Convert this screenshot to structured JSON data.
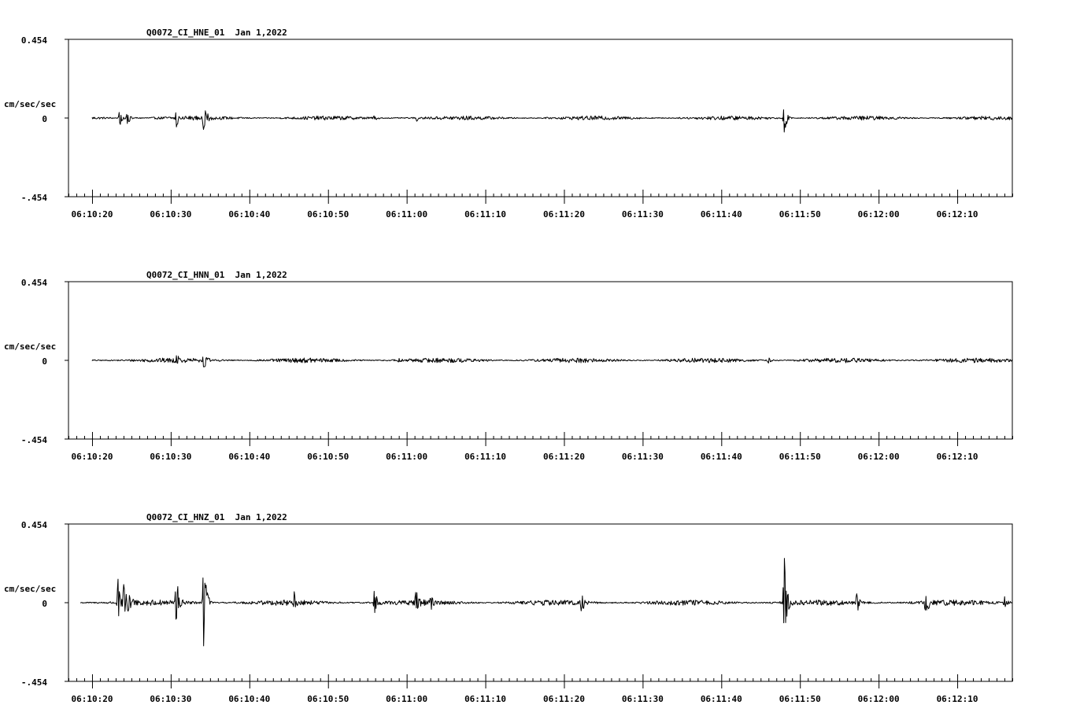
{
  "chart_data": [
    {
      "type": "line",
      "title": "Q0072_CI_HNE_01  Jan 1,2022",
      "ylabel": "cm/sec/sec",
      "ylim": [
        -0.454,
        0.454
      ],
      "y_tick_labels": [
        "0.454",
        "0",
        "-.454"
      ],
      "xlim_seconds_of_day": [
        22217.0,
        22337.0
      ],
      "x_tick_labels": [
        "06:10:20",
        "06:10:30",
        "06:10:40",
        "06:10:50",
        "06:11:00",
        "06:11:10",
        "06:11:20",
        "06:11:30",
        "06:11:40",
        "06:11:50",
        "06:12:00",
        "06:12:10"
      ],
      "grid": false,
      "series": [
        {
          "start_time": "06:10:20",
          "noise_amplitude": 0.012,
          "events": [
            {
              "time": "06:10:23.5",
              "amplitude": 0.05
            },
            {
              "time": "06:10:24.5",
              "amplitude": 0.05
            },
            {
              "time": "06:10:30.7",
              "amplitude": 0.06
            },
            {
              "time": "06:10:34.2",
              "amplitude": 0.11
            },
            {
              "time": "06:10:55.9",
              "amplitude": 0.02
            },
            {
              "time": "06:11:01.2",
              "amplitude": 0.02
            },
            {
              "time": "06:11:48.0",
              "amplitude": 0.1
            }
          ]
        }
      ]
    },
    {
      "type": "line",
      "title": "Q0072_CI_HNN_01  Jan 1,2022",
      "ylabel": "cm/sec/sec",
      "ylim": [
        -0.454,
        0.454
      ],
      "y_tick_labels": [
        "0.454",
        "0",
        "-.454"
      ],
      "xlim_seconds_of_day": [
        22217.0,
        22337.0
      ],
      "x_tick_labels": [
        "06:10:20",
        "06:10:30",
        "06:10:40",
        "06:10:50",
        "06:11:00",
        "06:11:10",
        "06:11:20",
        "06:11:30",
        "06:11:40",
        "06:11:50",
        "06:12:00",
        "06:12:10"
      ],
      "grid": false,
      "series": [
        {
          "start_time": "06:10:20",
          "noise_amplitude": 0.014,
          "events": [
            {
              "time": "06:10:30.7",
              "amplitude": 0.03
            },
            {
              "time": "06:10:34.2",
              "amplitude": 0.06
            },
            {
              "time": "06:10:59.0",
              "amplitude": 0.02
            },
            {
              "time": "06:11:46.0",
              "amplitude": 0.02
            }
          ]
        }
      ]
    },
    {
      "type": "line",
      "title": "Q0072_CI_HNZ_01  Jan 1,2022",
      "ylabel": "cm/sec/sec",
      "ylim": [
        -0.454,
        0.454
      ],
      "y_tick_labels": [
        "0.454",
        "0",
        "-.454"
      ],
      "xlim_seconds_of_day": [
        22217.0,
        22337.0
      ],
      "x_tick_labels": [
        "06:10:20",
        "06:10:30",
        "06:10:40",
        "06:10:50",
        "06:11:00",
        "06:11:10",
        "06:11:20",
        "06:11:30",
        "06:11:40",
        "06:11:50",
        "06:12:00",
        "06:12:10"
      ],
      "grid": false,
      "series": [
        {
          "start_time": "06:10:18.5",
          "noise_amplitude": 0.016,
          "events": [
            {
              "time": "06:10:23.3",
              "amplitude": 0.14
            },
            {
              "time": "06:10:24.0",
              "amplitude": 0.11
            },
            {
              "time": "06:10:24.5",
              "amplitude": 0.1
            },
            {
              "time": "06:10:30.7",
              "amplitude": 0.19
            },
            {
              "time": "06:10:34.2",
              "amplitude": 0.29
            },
            {
              "time": "06:10:45.7",
              "amplitude": 0.07
            },
            {
              "time": "06:10:55.9",
              "amplitude": 0.1
            },
            {
              "time": "06:11:01.2",
              "amplitude": 0.09
            },
            {
              "time": "06:11:03.0",
              "amplitude": 0.05
            },
            {
              "time": "06:11:22.2",
              "amplitude": 0.08
            },
            {
              "time": "06:11:48.0",
              "amplitude": 0.34
            },
            {
              "time": "06:11:57.2",
              "amplitude": 0.07
            },
            {
              "time": "06:12:06.0",
              "amplitude": 0.09
            },
            {
              "time": "06:12:16.0",
              "amplitude": 0.05
            }
          ]
        }
      ]
    }
  ]
}
